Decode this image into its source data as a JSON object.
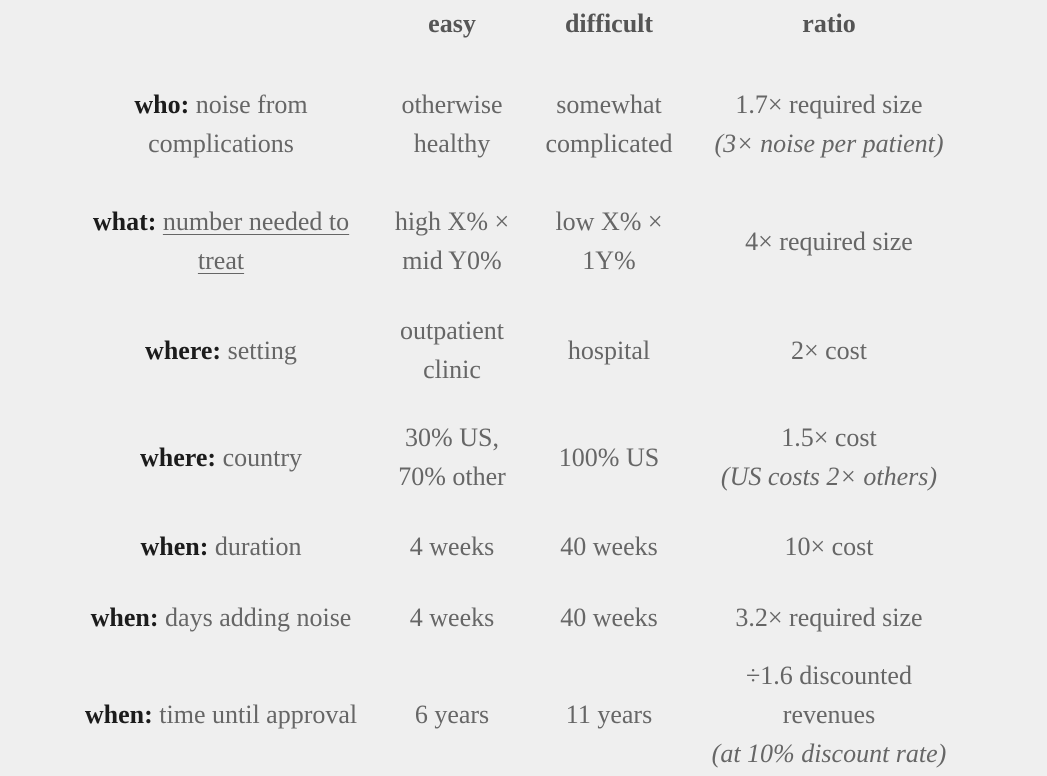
{
  "table": {
    "headers": [
      "",
      "easy",
      "difficult",
      "ratio"
    ],
    "rows": [
      {
        "key": "who:",
        "label": "noise from complications",
        "label_underlined": false,
        "easy": "otherwise healthy",
        "difficult": "somewhat complicated",
        "ratio": "1.7× required size",
        "ratio_note": "(3× noise per patient)"
      },
      {
        "key": "what:",
        "label": "number needed to treat",
        "label_underlined": true,
        "easy": "high X% × mid Y0%",
        "difficult": "low X% × 1Y%",
        "ratio": "4× required size",
        "ratio_note": ""
      },
      {
        "key": "where:",
        "label": "setting",
        "label_underlined": false,
        "easy": "outpatient clinic",
        "difficult": "hospital",
        "ratio": "2× cost",
        "ratio_note": ""
      },
      {
        "key": "where:",
        "label": "country",
        "label_underlined": false,
        "easy": "30% US, 70% other",
        "difficult": "100% US",
        "ratio": "1.5× cost",
        "ratio_note": "(US costs 2× others)"
      },
      {
        "key": "when:",
        "label": "duration",
        "label_underlined": false,
        "easy": "4 weeks",
        "difficult": "40 weeks",
        "ratio": "10× cost",
        "ratio_note": ""
      },
      {
        "key": "when:",
        "label": "days adding noise",
        "label_underlined": false,
        "easy": "4 weeks",
        "difficult": "40 weeks",
        "ratio": "3.2× required size",
        "ratio_note": ""
      },
      {
        "key": "when:",
        "label": "time until approval",
        "label_underlined": false,
        "easy": "6 years",
        "difficult": "11 years",
        "ratio": "÷1.6 discounted revenues",
        "ratio_note": "(at 10% discount rate)"
      }
    ]
  },
  "colors": {
    "background": "#efefef",
    "key_text": "#1c1c1c",
    "body_text": "#666666"
  }
}
